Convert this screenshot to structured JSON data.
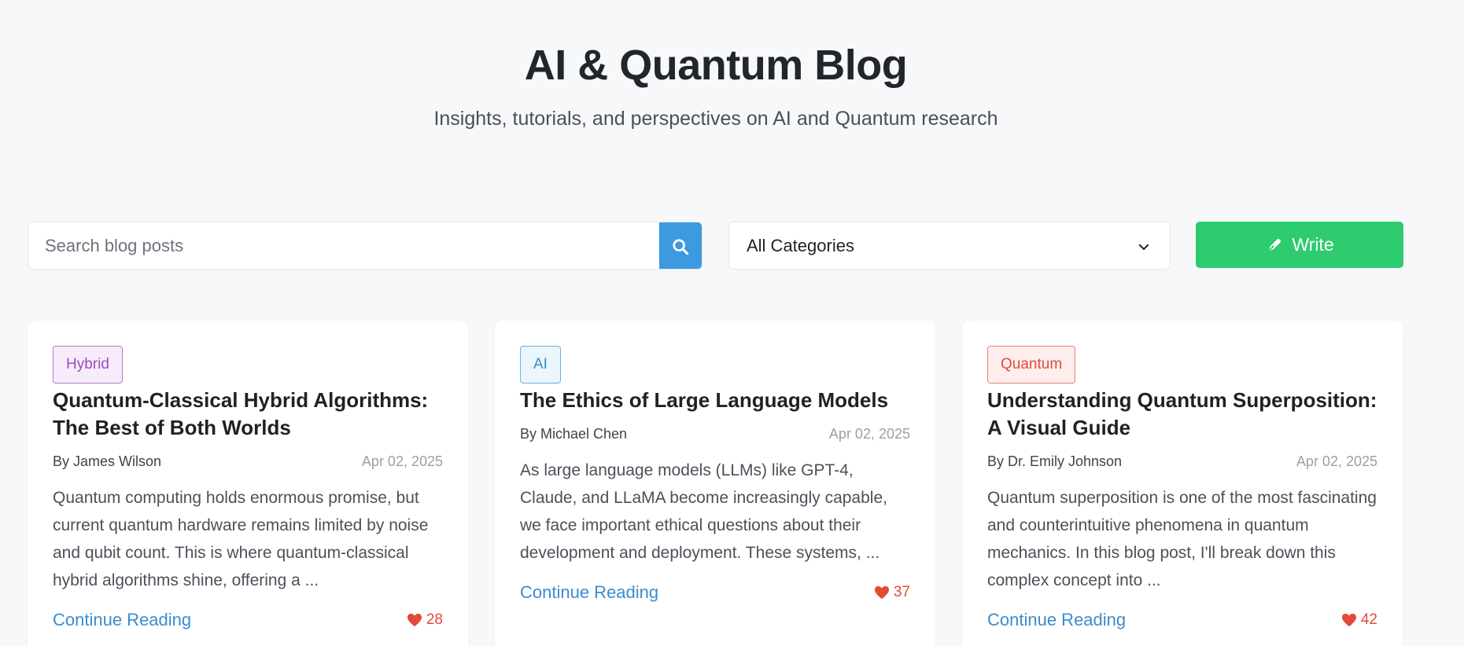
{
  "header": {
    "title": "AI & Quantum Blog",
    "subtitle": "Insights, tutorials, and perspectives on AI and Quantum research"
  },
  "toolbar": {
    "search_placeholder": "Search blog posts",
    "search_icon": "search-icon",
    "category_selected": "All Categories",
    "write_label": "Write",
    "write_icon": "pen-icon"
  },
  "colors": {
    "background": "#f7f8fa",
    "search_button": "#3d9ae0",
    "write_button": "#2ecb6f",
    "link": "#3a8cd0",
    "heart": "#e34a3a"
  },
  "posts": [
    {
      "category": "Hybrid",
      "title": "Quantum-Classical Hybrid Algorithms: The Best of Both Worlds",
      "author": "By James Wilson",
      "date": "Apr 02, 2025",
      "excerpt": "Quantum computing holds enormous promise, but current quantum hardware remains limited by noise and qubit count. This is where quantum-classical hybrid algorithms shine, offering a ...",
      "cta": "Continue Reading",
      "likes": "28"
    },
    {
      "category": "AI",
      "title": "The Ethics of Large Language Models",
      "author": "By Michael Chen",
      "date": "Apr 02, 2025",
      "excerpt": "As large language models (LLMs) like GPT-4, Claude, and LLaMA become increasingly capable, we face important ethical questions about their development and deployment. These systems, ...",
      "cta": "Continue Reading",
      "likes": "37"
    },
    {
      "category": "Quantum",
      "title": "Understanding Quantum Superposition: A Visual Guide",
      "author": "By Dr. Emily Johnson",
      "date": "Apr 02, 2025",
      "excerpt": "Quantum superposition is one of the most fascinating and counterintuitive phenomena in quantum mechanics. In this blog post, I'll break down this complex concept into ...",
      "cta": "Continue Reading",
      "likes": "42"
    }
  ]
}
